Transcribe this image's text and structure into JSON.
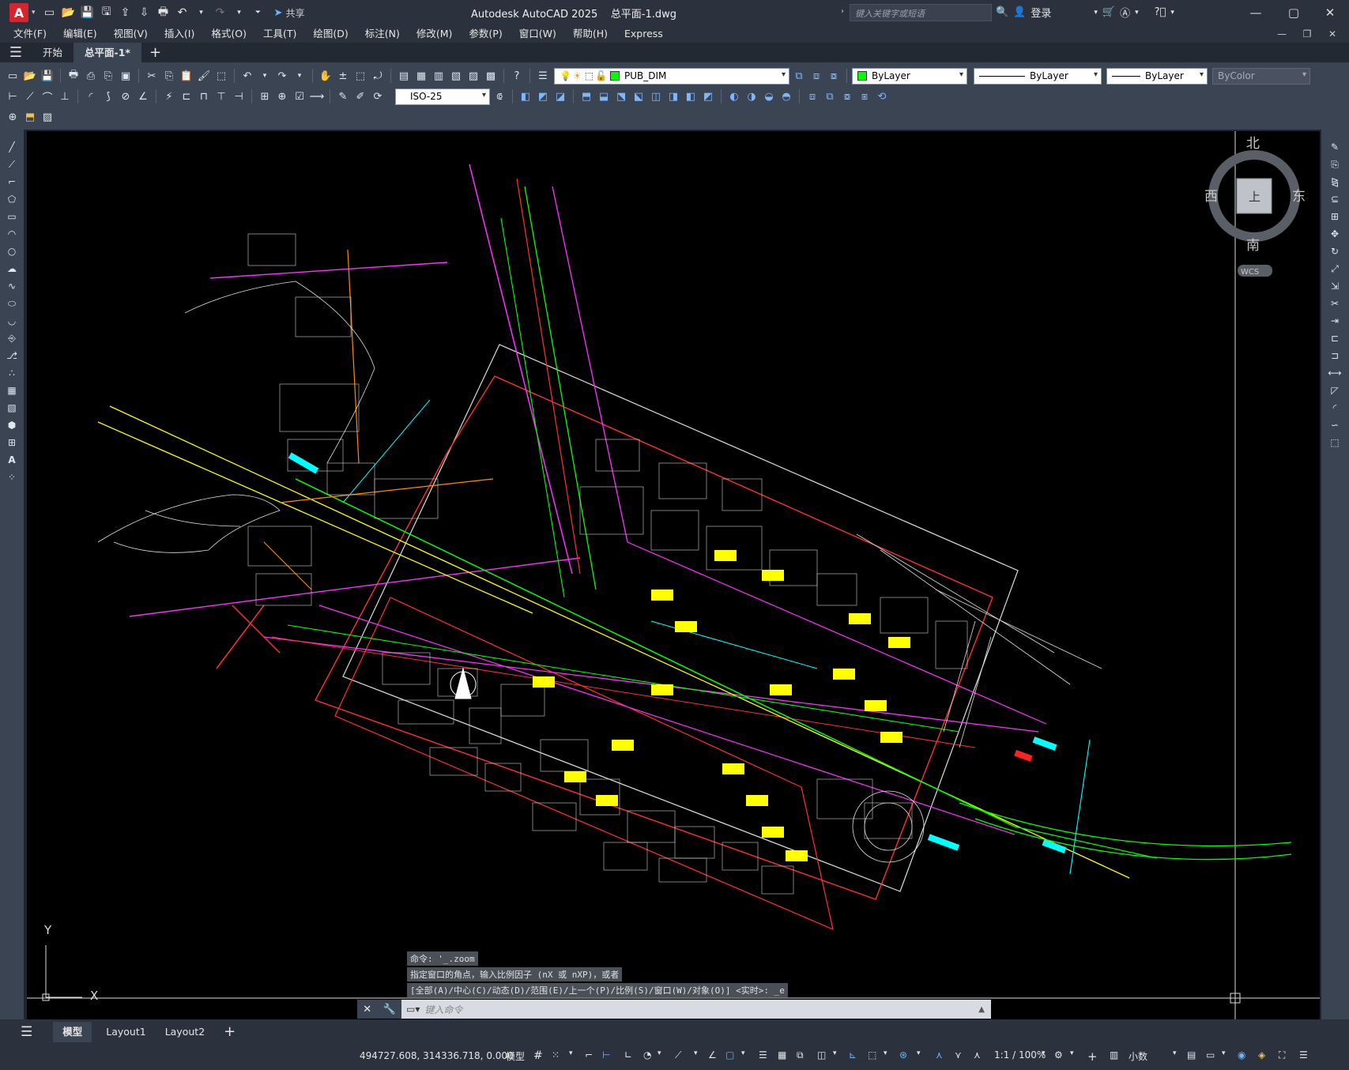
{
  "app": {
    "title": "Autodesk AutoCAD 2025",
    "document": "总平面-1.dwg",
    "logo_letter": "A",
    "share_label": "共享"
  },
  "search": {
    "placeholder": "键入关键字或短语"
  },
  "user": {
    "login_label": "登录"
  },
  "menu": [
    "文件(F)",
    "编辑(E)",
    "视图(V)",
    "插入(I)",
    "格式(O)",
    "工具(T)",
    "绘图(D)",
    "标注(N)",
    "修改(M)",
    "参数(P)",
    "窗口(W)",
    "帮助(H)",
    "Express"
  ],
  "doc_tabs": {
    "start": "开始",
    "active": "总平面-1*"
  },
  "layer": {
    "name": "PUB_DIM",
    "color": "#00ff00"
  },
  "properties": {
    "color": "ByLayer",
    "linetype": "ByLayer",
    "lineweight": "ByLayer",
    "plotstyle": "ByColor"
  },
  "dimstyle": "ISO-25",
  "viewcube": {
    "north": "北",
    "south": "南",
    "east": "东",
    "west": "西",
    "top": "上",
    "wcs": "WCS"
  },
  "ucs": {
    "x": "X",
    "y": "Y"
  },
  "command": {
    "history": [
      "命令: '_.zoom",
      "指定窗口的角点，输入比例因子 (nX 或 nXP)，或者",
      "[全部(A)/中心(C)/动态(D)/范围(E)/上一个(P)/比例(S)/窗口(W)/对象(O)] <实时>: _e"
    ],
    "placeholder": "键入命令"
  },
  "layout_tabs": [
    "模型",
    "Layout1",
    "Layout2"
  ],
  "status": {
    "coords": "494727.608, 314336.718, 0.000",
    "model": "模型",
    "scale": "1:1 / 100%",
    "units": "小数"
  }
}
